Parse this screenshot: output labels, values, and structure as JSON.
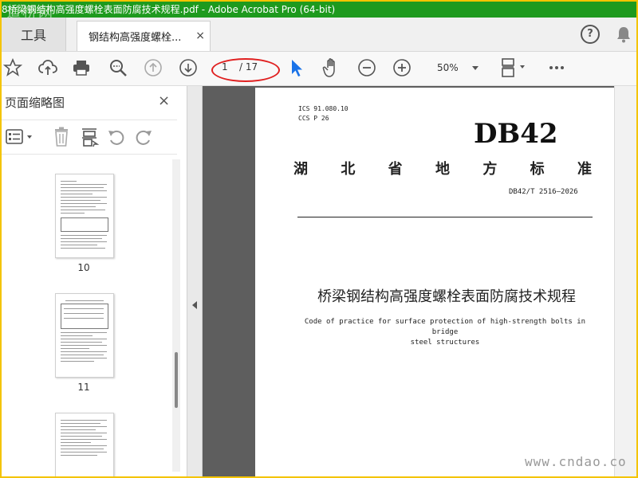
{
  "window": {
    "title": "8桥梁钢结构高强度螺栓表面防腐技术规程.pdf - Adobe Acrobat Pro (64-bit)",
    "watermark_top": "道桥网"
  },
  "tabs": {
    "tools_label": "工具",
    "document_label": "钢结构高强度螺栓...",
    "close_symbol": "×"
  },
  "toolbar": {
    "page_current": "1",
    "page_total": "/ 17",
    "zoom_value": "50%"
  },
  "sidebar": {
    "title": "页面缩略图",
    "close_symbol": "×",
    "thumbnails": [
      {
        "number": "10"
      },
      {
        "number": "11"
      },
      {
        "number": ""
      }
    ]
  },
  "document": {
    "ics": "ICS 91.080.10",
    "ccs": "CCS P 26",
    "code": "DB42",
    "province_chars": [
      "湖",
      "北",
      "省",
      "地",
      "方",
      "标",
      "准"
    ],
    "standard_number": "DB42/T 2516—2026",
    "title_cn": "桥梁钢结构高强度螺栓表面防腐技术规程",
    "title_en_line1": "Code of practice for surface protection of high-strength bolts in bridge",
    "title_en_line2": "steel structures"
  },
  "watermark_bottom": "www.cndao.co",
  "colors": {
    "titlebar": "#1e9a1e",
    "border": "#f4c400",
    "annotation_circle": "#e02020",
    "select_tool": "#1a73e8"
  }
}
